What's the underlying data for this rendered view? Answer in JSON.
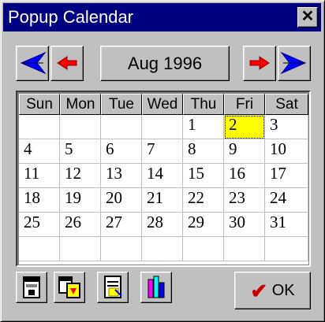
{
  "window": {
    "title": "Popup Calendar",
    "close_glyph": "✕"
  },
  "nav": {
    "month_label": "Aug 1996",
    "prev_year_icon": "double-left-arrow-icon",
    "prev_month_icon": "left-arrow-icon",
    "next_month_icon": "right-arrow-icon",
    "next_year_icon": "double-right-arrow-icon",
    "colors": {
      "blue": "#0000ff",
      "red": "#ff0000"
    }
  },
  "calendar": {
    "weekdays": [
      "Sun",
      "Mon",
      "Tue",
      "Wed",
      "Thu",
      "Fri",
      "Sat"
    ],
    "weeks": [
      [
        "",
        "",
        "",
        "",
        "1",
        "2",
        "3"
      ],
      [
        "4",
        "5",
        "6",
        "7",
        "8",
        "9",
        "10"
      ],
      [
        "11",
        "12",
        "13",
        "14",
        "15",
        "16",
        "17"
      ],
      [
        "18",
        "19",
        "20",
        "21",
        "22",
        "23",
        "24"
      ],
      [
        "25",
        "26",
        "27",
        "28",
        "29",
        "30",
        "31"
      ],
      [
        "",
        "",
        "",
        "",
        "",
        "",
        ""
      ]
    ],
    "selected_day": "2",
    "selected_color": "#ffff00"
  },
  "toolbar": {
    "buttons": [
      {
        "name": "today-button",
        "icon": "calendar-today-icon"
      },
      {
        "name": "copy-button",
        "icon": "copy-date-icon"
      },
      {
        "name": "note-button",
        "icon": "notepad-icon"
      },
      {
        "name": "chart-button",
        "icon": "bar-chart-icon"
      }
    ],
    "ok_label": "OK",
    "ok_glyph": "✔"
  }
}
